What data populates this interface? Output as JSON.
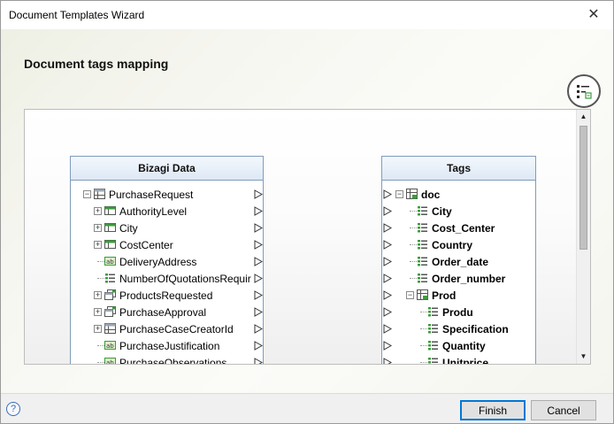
{
  "window": {
    "title": "Document Templates Wizard"
  },
  "heading": "Document tags mapping",
  "left_panel": {
    "header": "Bizagi Data",
    "rows": [
      {
        "label": "PurchaseRequest",
        "expander": "−",
        "icon": "table-icon"
      },
      {
        "label": "AuthorityLevel",
        "expander": "+",
        "icon": "entity-icon"
      },
      {
        "label": "City",
        "expander": "+",
        "icon": "entity-icon"
      },
      {
        "label": "CostCenter",
        "expander": "+",
        "icon": "entity-icon"
      },
      {
        "label": "DeliveryAddress",
        "expander": "",
        "icon": "text-field-icon"
      },
      {
        "label": "NumberOfQuotationsRequir",
        "expander": "",
        "icon": "number-field-icon"
      },
      {
        "label": "ProductsRequested",
        "expander": "+",
        "icon": "collection-icon"
      },
      {
        "label": "PurchaseApproval",
        "expander": "+",
        "icon": "collection-icon"
      },
      {
        "label": "PurchaseCaseCreatorId",
        "expander": "+",
        "icon": "table-icon"
      },
      {
        "label": "PurchaseJustification",
        "expander": "",
        "icon": "text-field-icon"
      },
      {
        "label": "PurchaseObservations",
        "expander": "",
        "icon": "text-field-icon"
      }
    ]
  },
  "right_panel": {
    "header": "Tags",
    "rows": [
      {
        "label": "doc",
        "expander": "−",
        "icon": "doc-table-icon"
      },
      {
        "label": "City",
        "expander": "",
        "icon": "tag-icon"
      },
      {
        "label": "Cost_Center",
        "expander": "",
        "icon": "tag-icon"
      },
      {
        "label": "Country",
        "expander": "",
        "icon": "tag-icon"
      },
      {
        "label": "Order_date",
        "expander": "",
        "icon": "tag-icon"
      },
      {
        "label": "Order_number",
        "expander": "",
        "icon": "tag-icon"
      },
      {
        "label": "Prod",
        "expander": "−",
        "icon": "doc-table-icon"
      },
      {
        "label": "Produ",
        "expander": "",
        "icon": "tag-icon"
      },
      {
        "label": "Specification",
        "expander": "",
        "icon": "tag-icon"
      },
      {
        "label": "Quantity",
        "expander": "",
        "icon": "tag-icon"
      },
      {
        "label": "Unitprice",
        "expander": "",
        "icon": "tag-icon"
      }
    ]
  },
  "footer": {
    "help_glyph": "?",
    "finish_label": "Finish",
    "cancel_label": "Cancel"
  },
  "colors": {
    "accent": "#0078d7",
    "panel_border": "#7f9db9",
    "icon_green": "#3c9b3c"
  }
}
